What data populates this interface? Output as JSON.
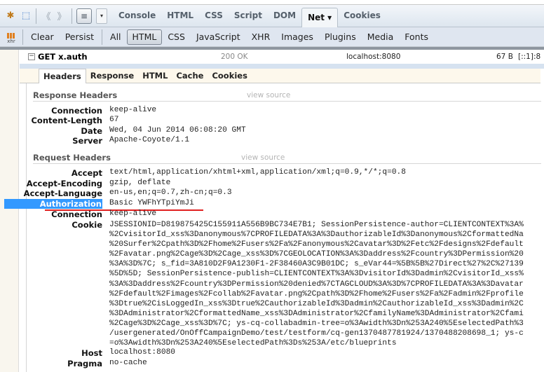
{
  "toolbar": {
    "icons": [
      "firebug-bug-icon",
      "inspect-element-icon",
      "back-icon",
      "forward-icon"
    ],
    "panel_menu_icon": "list-icon",
    "dropdown_icon": "dropdown-arrow-icon",
    "tabs": [
      {
        "label": "Console",
        "active": false
      },
      {
        "label": "HTML",
        "active": false
      },
      {
        "label": "CSS",
        "active": false
      },
      {
        "label": "Script",
        "active": false
      },
      {
        "label": "DOM",
        "active": false
      },
      {
        "label": "Net ▾",
        "active": true
      },
      {
        "label": "Cookies",
        "active": false
      }
    ]
  },
  "net_toolbar": {
    "xhr_icon_label": "xhr",
    "clear": "Clear",
    "persist": "Persist",
    "filters": [
      {
        "label": "All",
        "active": false
      },
      {
        "label": "HTML",
        "active": true
      },
      {
        "label": "CSS",
        "active": false
      },
      {
        "label": "JavaScript",
        "active": false
      },
      {
        "label": "XHR",
        "active": false
      },
      {
        "label": "Images",
        "active": false
      },
      {
        "label": "Plugins",
        "active": false
      },
      {
        "label": "Media",
        "active": false
      },
      {
        "label": "Fonts",
        "active": false
      }
    ]
  },
  "request": {
    "toggle": "−",
    "method_url": "GET x.auth",
    "status": "200 OK",
    "domain": "localhost:8080",
    "size": "67 B",
    "remote": "[::1]:8"
  },
  "detail_tabs": [
    {
      "label": "Headers",
      "active": true
    },
    {
      "label": "Response",
      "active": false
    },
    {
      "label": "HTML",
      "active": false
    },
    {
      "label": "Cache",
      "active": false
    },
    {
      "label": "Cookies",
      "active": false
    }
  ],
  "response_headers": {
    "title": "Response Headers",
    "view_source": "view source",
    "rows": [
      {
        "name": "Connection",
        "value": "keep-alive"
      },
      {
        "name": "Content-Length",
        "value": "67"
      },
      {
        "name": "Date",
        "value": "Wed, 04 Jun 2014 06:08:20 GMT"
      },
      {
        "name": "Server",
        "value": "Apache-Coyote/1.1"
      }
    ]
  },
  "request_headers": {
    "title": "Request Headers",
    "view_source": "view source",
    "rows": [
      {
        "name": "Accept",
        "value": "text/html,application/xhtml+xml,application/xml;q=0.9,*/*;q=0.8"
      },
      {
        "name": "Accept-Encoding",
        "value": "gzip, deflate"
      },
      {
        "name": "Accept-Language",
        "value": "en-us,en;q=0.7,zh-cn;q=0.3"
      },
      {
        "name": "Authorization",
        "value": "Basic YWFhYTpiYmJi",
        "highlighted": true
      },
      {
        "name": "Connection",
        "value": "keep-alive"
      },
      {
        "name": "Cookie",
        "value": "JSESSIONID=D819875425C155911A556B9BC734E7B1; SessionPersistence-author=CLIENTCONTEXT%3A%\n%2CvisitorId_xss%3Danonymous%7CPROFILEDATA%3A%3DauthorizableId%3Danonymous%2CformattedNa\n%20Surfer%2Cpath%3D%2Fhome%2Fusers%2Fa%2Fanonymous%2Cavatar%3D%2Fetc%2Fdesigns%2Fdefault\n%2Favatar.png%2Cage%3D%2Cage_xss%3D%7CGEOLOCATION%3A%3Daddress%2Fcountry%3DPermission%20\n%3A%3D%7C; s_fid=3A810D2F9A1230F1-2F38460A3C9B01DC; s_eVar44=%5B%5B%27Direct%27%2C%27139\n%5D%5D; SessionPersistence-publish=CLIENTCONTEXT%3A%3DvisitorId%3Dadmin%2CvisitorId_xss%\n%3A%3Daddress%2Fcountry%3DPermission%20denied%7CTAGCLOUD%3A%3D%7CPROFILEDATA%3A%3Davatar\n%2Fdefault%2Fimages%2Fcollab%2Favatar.png%2Cpath%3D%2Fhome%2Fusers%2Fa%2Fadmin%2Fprofile\n%3Dtrue%2CisLoggedIn_xss%3Dtrue%2CauthorizableId%3Dadmin%2CauthorizableId_xss%3Dadmin%2C\n%3DAdministrator%2CformattedName_xss%3DAdministrator%2CfamilyName%3DAdministrator%2Cfami\n%2Cage%3D%2Cage_xss%3D%7C; ys-cq-collabadmin-tree=o%3Awidth%3Dn%253A240%5EselectedPath%3\n/usergenerated/OnOffCampaignDemo/test/testform/cq-gen1370487781924/1370488208698_1; ys-c\n=o%3Awidth%3Dn%253A240%5EselectedPath%3Ds%253A/etc/blueprints"
      },
      {
        "name": "Host",
        "value": "localhost:8080"
      },
      {
        "name": "Pragma",
        "value": "no-cache"
      }
    ]
  }
}
